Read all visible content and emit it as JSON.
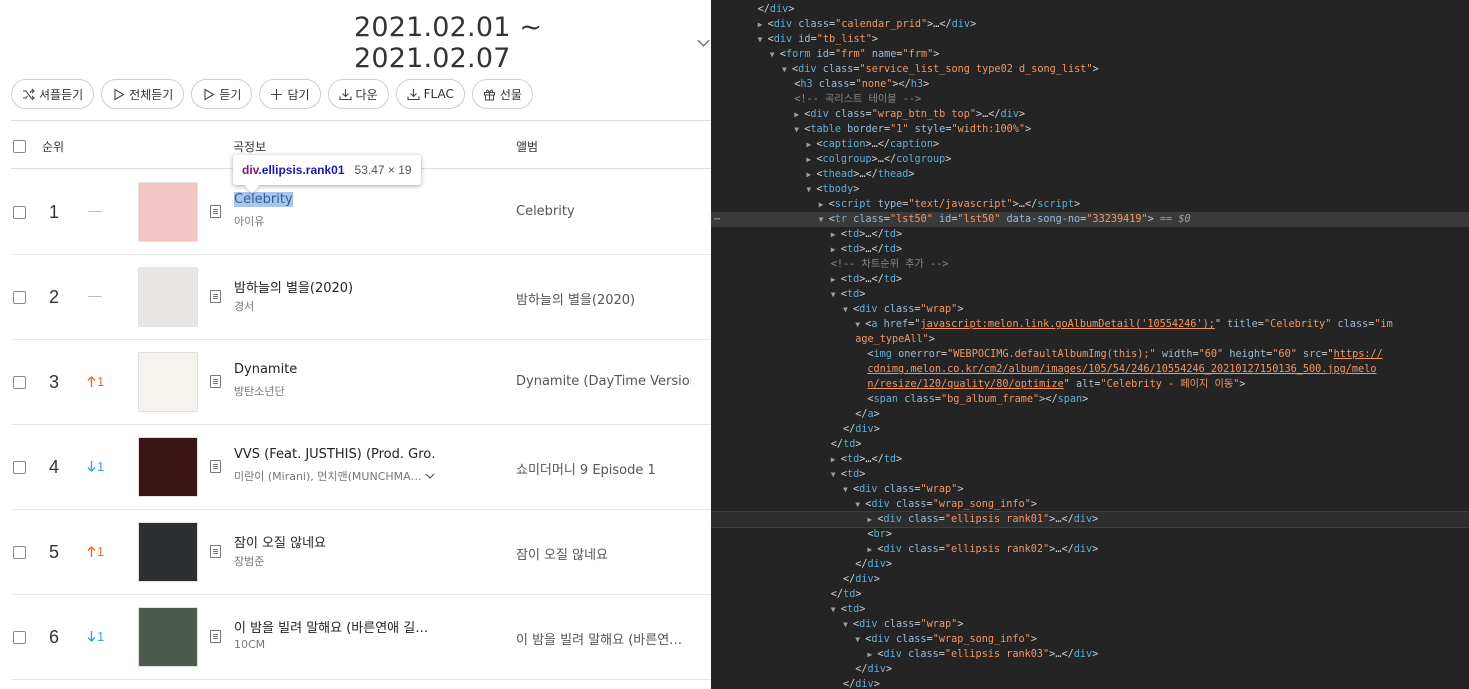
{
  "chart": {
    "date_range": "2021.02.01 ~ 2021.02.07",
    "toolbar": [
      {
        "label": "셔플듣기",
        "icon": "shuffle-icon"
      },
      {
        "label": "전체듣기",
        "icon": "play-icon"
      },
      {
        "label": "듣기",
        "icon": "play-icon"
      },
      {
        "label": "담기",
        "icon": "plus-icon"
      },
      {
        "label": "다운",
        "icon": "download-icon"
      },
      {
        "label": "FLAC",
        "icon": "download-icon"
      },
      {
        "label": "선물",
        "icon": "gift-icon"
      }
    ],
    "headers": {
      "rank": "순위",
      "song_info": "곡정보",
      "album": "앨범"
    },
    "rows": [
      {
        "rank": "1",
        "change_dir": "same",
        "change": "",
        "title": "Celebrity",
        "artist": "아이유",
        "album": "Celebrity",
        "cover_color": "#f3c6c6"
      },
      {
        "rank": "2",
        "change_dir": "same",
        "change": "",
        "title": "밤하늘의 별을(2020)",
        "artist": "경서",
        "album": "밤하늘의 별을(2020)",
        "cover_color": "#e9e6e3"
      },
      {
        "rank": "3",
        "change_dir": "up",
        "change": "1",
        "title": "Dynamite",
        "artist": "방탄소년단",
        "album": "Dynamite (DayTime Version)",
        "cover_color": "#f6f2ee"
      },
      {
        "rank": "4",
        "change_dir": "down",
        "change": "1",
        "title": "VVS (Feat. JUSTHIS) (Prod. Gro…",
        "artist": "미란이 (Mirani), 먼치맨(MUNCHMA…",
        "album": "쇼미더머니 9 Episode 1",
        "cover_color": "#3a1518"
      },
      {
        "rank": "5",
        "change_dir": "up",
        "change": "1",
        "title": "잠이 오질 않네요",
        "artist": "장범준",
        "album": "잠이 오질 않네요",
        "cover_color": "#2b2f30"
      },
      {
        "rank": "6",
        "change_dir": "down",
        "change": "1",
        "title": "이 밤을 빌려 말해요 (바른연애 길…",
        "artist": "10CM",
        "album": "이 밤을 빌려 말해요 (바른연…",
        "cover_color": "#4f5a4f"
      }
    ],
    "tooltip": {
      "tag": "div",
      "classes": ".ellipsis.rank01",
      "size": "53.47 × 19"
    }
  },
  "devtools": {
    "lines": [
      {
        "indent": 6,
        "arrow": "",
        "html": "close",
        "tag": "div"
      },
      {
        "indent": 6,
        "arrow": "right",
        "html": "tag",
        "tag": "div",
        "attrs": [
          [
            "class",
            "calendar_prid"
          ]
        ],
        "collapsed": true
      },
      {
        "indent": 6,
        "arrow": "down",
        "html": "tag",
        "tag": "div",
        "attrs": [
          [
            "id",
            "tb_list"
          ]
        ]
      },
      {
        "indent": 8,
        "arrow": "down",
        "html": "tag",
        "tag": "form",
        "attrs": [
          [
            "id",
            "frm"
          ],
          [
            "name",
            "frm"
          ]
        ]
      },
      {
        "indent": 10,
        "arrow": "down",
        "html": "tag",
        "tag": "div",
        "attrs": [
          [
            "class",
            "service_list_song type02 d_song_list"
          ]
        ]
      },
      {
        "indent": 12,
        "arrow": "",
        "html": "inline",
        "tag": "h3",
        "attrs": [
          [
            "class",
            "none"
          ]
        ]
      },
      {
        "indent": 12,
        "arrow": "",
        "html": "comment",
        "text": "<!-- 곡리스트 테이블 -->"
      },
      {
        "indent": 12,
        "arrow": "right",
        "html": "tag",
        "tag": "div",
        "attrs": [
          [
            "class",
            "wrap_btn_tb top"
          ]
        ],
        "collapsed": true
      },
      {
        "indent": 12,
        "arrow": "down",
        "html": "tag",
        "tag": "table",
        "attrs": [
          [
            "border",
            "1"
          ],
          [
            "style",
            "width:100%"
          ]
        ]
      },
      {
        "indent": 14,
        "arrow": "right",
        "html": "tag",
        "tag": "caption",
        "attrs": [],
        "collapsed": true
      },
      {
        "indent": 14,
        "arrow": "right",
        "html": "tag",
        "tag": "colgroup",
        "attrs": [],
        "collapsed": true
      },
      {
        "indent": 14,
        "arrow": "right",
        "html": "tag",
        "tag": "thead",
        "attrs": [],
        "collapsed": true
      },
      {
        "indent": 14,
        "arrow": "down",
        "html": "tag",
        "tag": "tbody",
        "attrs": []
      },
      {
        "indent": 16,
        "arrow": "right",
        "html": "tag",
        "tag": "script",
        "attrs": [
          [
            "type",
            "text/javascript"
          ]
        ],
        "collapsed": true
      },
      {
        "indent": 16,
        "arrow": "down",
        "html": "tag",
        "tag": "tr",
        "attrs": [
          [
            "class",
            "lst50"
          ],
          [
            "id",
            "lst50"
          ],
          [
            "data-song-no",
            "33239419"
          ]
        ],
        "selected": true
      },
      {
        "indent": 18,
        "arrow": "right",
        "html": "tag",
        "tag": "td",
        "attrs": [],
        "collapsed": true
      },
      {
        "indent": 18,
        "arrow": "right",
        "html": "tag",
        "tag": "td",
        "attrs": [],
        "collapsed": true
      },
      {
        "indent": 18,
        "arrow": "",
        "html": "comment",
        "text": "<!-- 차트순위 추가 -->"
      },
      {
        "indent": 18,
        "arrow": "right",
        "html": "tag",
        "tag": "td",
        "attrs": [],
        "collapsed": true
      },
      {
        "indent": 18,
        "arrow": "down",
        "html": "tag",
        "tag": "td",
        "attrs": []
      },
      {
        "indent": 20,
        "arrow": "down",
        "html": "tag",
        "tag": "div",
        "attrs": [
          [
            "class",
            "wrap"
          ]
        ]
      },
      {
        "indent": 22,
        "arrow": "down",
        "html": "raw",
        "text": "a_href"
      },
      {
        "indent": 22,
        "arrow": "",
        "html": "raw",
        "text": "a_cont"
      },
      {
        "indent": 24,
        "arrow": "",
        "html": "raw",
        "text": "img1"
      },
      {
        "indent": 24,
        "arrow": "",
        "html": "raw",
        "text": "img2"
      },
      {
        "indent": 24,
        "arrow": "",
        "html": "raw",
        "text": "img3"
      },
      {
        "indent": 24,
        "arrow": "",
        "html": "inline",
        "tag": "span",
        "attrs": [
          [
            "class",
            "bg_album_frame"
          ]
        ]
      },
      {
        "indent": 22,
        "arrow": "",
        "html": "close",
        "tag": "a"
      },
      {
        "indent": 20,
        "arrow": "",
        "html": "close",
        "tag": "div"
      },
      {
        "indent": 18,
        "arrow": "",
        "html": "close",
        "tag": "td"
      },
      {
        "indent": 18,
        "arrow": "right",
        "html": "tag",
        "tag": "td",
        "attrs": [],
        "collapsed": true
      },
      {
        "indent": 18,
        "arrow": "down",
        "html": "tag",
        "tag": "td",
        "attrs": []
      },
      {
        "indent": 20,
        "arrow": "down",
        "html": "tag",
        "tag": "div",
        "attrs": [
          [
            "class",
            "wrap"
          ]
        ]
      },
      {
        "indent": 22,
        "arrow": "down",
        "html": "tag",
        "tag": "div",
        "attrs": [
          [
            "class",
            "wrap_song_info"
          ]
        ]
      },
      {
        "indent": 24,
        "arrow": "right",
        "html": "tag",
        "tag": "div",
        "attrs": [
          [
            "class",
            "ellipsis rank01"
          ]
        ],
        "collapsed": true,
        "hover": true
      },
      {
        "indent": 24,
        "arrow": "",
        "html": "void",
        "tag": "br"
      },
      {
        "indent": 24,
        "arrow": "right",
        "html": "tag",
        "tag": "div",
        "attrs": [
          [
            "class",
            "ellipsis rank02"
          ]
        ],
        "collapsed": true
      },
      {
        "indent": 22,
        "arrow": "",
        "html": "close",
        "tag": "div"
      },
      {
        "indent": 20,
        "arrow": "",
        "html": "close",
        "tag": "div"
      },
      {
        "indent": 18,
        "arrow": "",
        "html": "close",
        "tag": "td"
      },
      {
        "indent": 18,
        "arrow": "down",
        "html": "tag",
        "tag": "td",
        "attrs": []
      },
      {
        "indent": 20,
        "arrow": "down",
        "html": "tag",
        "tag": "div",
        "attrs": [
          [
            "class",
            "wrap"
          ]
        ]
      },
      {
        "indent": 22,
        "arrow": "down",
        "html": "tag",
        "tag": "div",
        "attrs": [
          [
            "class",
            "wrap_song_info"
          ]
        ]
      },
      {
        "indent": 24,
        "arrow": "right",
        "html": "tag",
        "tag": "div",
        "attrs": [
          [
            "class",
            "ellipsis rank03"
          ]
        ],
        "collapsed": true
      },
      {
        "indent": 22,
        "arrow": "",
        "html": "close",
        "tag": "div"
      },
      {
        "indent": 20,
        "arrow": "",
        "html": "close",
        "tag": "div"
      }
    ],
    "selected_marker": "== $0",
    "a_href_parts": {
      "href": "javascript:melon.link.goAlbumDetail('10554246');",
      "title": "Celebrity",
      "class_start": "im",
      "class_end": "age_typeAll"
    },
    "img_parts": {
      "onerror": "WEBPOCIMG.defaultAlbumImg(this);",
      "width": "60",
      "height": "60",
      "src1": "https://",
      "src2": "cdnimg.melon.co.kr/cm2/album/images/105/54/246/10554246_20210127150136_500.jpg/melo",
      "src3": "n/resize/120/quality/80/optimize",
      "alt": "Celebrity - 페이지 이동"
    }
  }
}
